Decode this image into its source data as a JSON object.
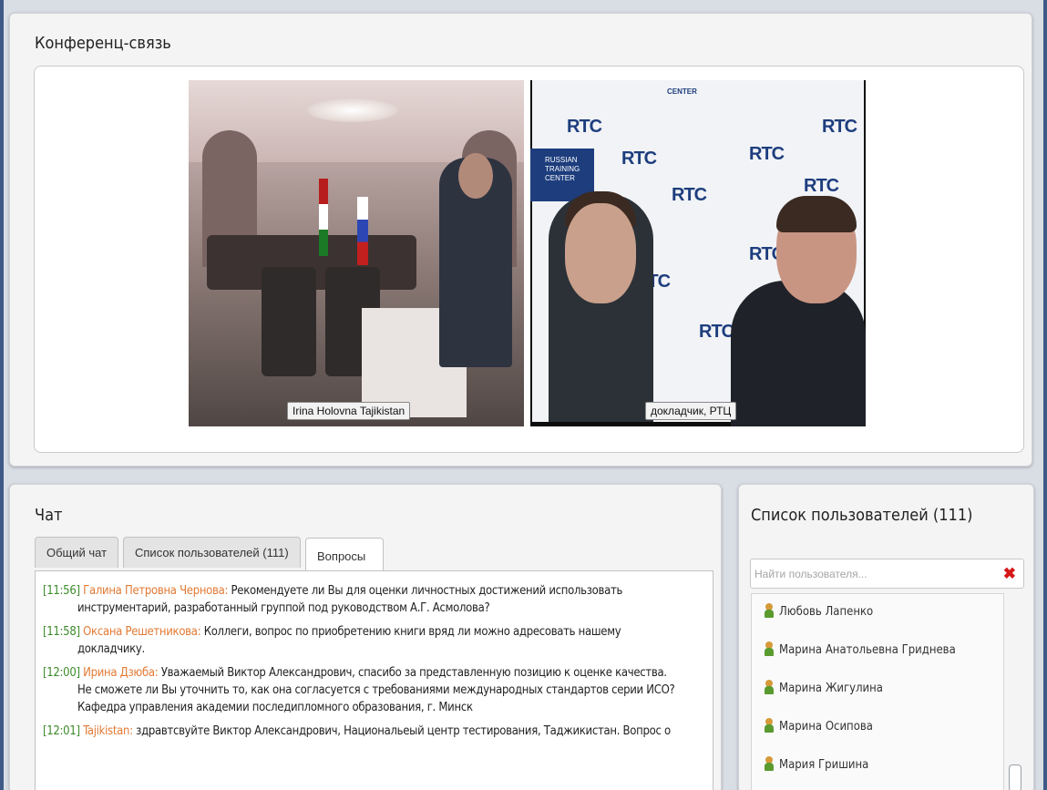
{
  "conference": {
    "title": "Конференц-связь",
    "videos": [
      {
        "caption": "Irina Holovna Tajikistan"
      },
      {
        "caption": "докладчик,  РТЦ"
      }
    ],
    "rtc_logo": "RTC",
    "banner_text": "RUSSIAN TRAINING CENTER",
    "banner_top": "CENTER"
  },
  "chat": {
    "title": "Чат",
    "tabs": [
      {
        "label": "Общий чат"
      },
      {
        "label": "Список пользователей (111)"
      },
      {
        "label": "Вопросы",
        "active": true
      }
    ],
    "messages": [
      {
        "time": "[11:56]",
        "author": "Галина Петровна Чернова:",
        "text": "Рекомендуете ли Вы для оценки личностных достижений использовать инструментарий, разработанный группой под руководством А.Г. Асмолова?"
      },
      {
        "time": "[11:58]",
        "author": "Оксана Решетникова:",
        "text": "Коллеги, вопрос по приобретению книги вряд ли можно адресовать нашему докладчику."
      },
      {
        "time": "[12:00]",
        "author": "Ирина Дзюба:",
        "text": "Уважаемый Виктор Александрович, спасибо за представленную позицию к оценке качества. Не сможете ли Вы уточнить то, как она согласуется с  требованиями международных стандартов серии ИСО? Кафедра управления академии последипломного образования, г. Минск"
      },
      {
        "time": "[12:01]",
        "author": "Tajikistan:",
        "text": "здравтсвуйте Виктор Александрович, Национальеый центр тестирования, Таджикистан. Вопрос о"
      }
    ]
  },
  "users": {
    "title": "Список пользователей (111)",
    "search_placeholder": "Найти пользователя...",
    "clear_glyph": "✖",
    "list": [
      {
        "name": "Любовь Лапенко"
      },
      {
        "name": "Марина Анатольевна Гриднева"
      },
      {
        "name": "Марина Жигулина"
      },
      {
        "name": "Марина Осипова"
      },
      {
        "name": "Мария Гришина"
      }
    ]
  }
}
